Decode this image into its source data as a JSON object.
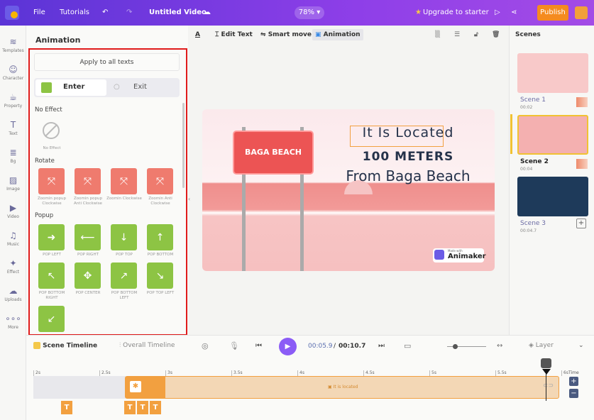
{
  "topbar": {
    "file": "File",
    "tutorials": "Tutorials",
    "title": "Untitled Video",
    "zoom": "78%",
    "upgrade": "Upgrade to starter",
    "publish": "Publish"
  },
  "rail": [
    {
      "label": "Templates",
      "icon": "template-icon"
    },
    {
      "label": "Character",
      "icon": "character-icon"
    },
    {
      "label": "Property",
      "icon": "property-icon"
    },
    {
      "label": "Text",
      "icon": "text-icon"
    },
    {
      "label": "Bg",
      "icon": "bg-icon"
    },
    {
      "label": "Image",
      "icon": "image-icon"
    },
    {
      "label": "Video",
      "icon": "video-icon"
    },
    {
      "label": "Music",
      "icon": "music-icon"
    },
    {
      "label": "Effect",
      "icon": "effect-icon"
    },
    {
      "label": "Uploads",
      "icon": "upload-icon"
    },
    {
      "label": "More",
      "icon": "more-icon"
    }
  ],
  "panel": {
    "title": "Animation",
    "apply": "Apply to all texts",
    "enter": "Enter",
    "exit": "Exit",
    "no_effect_section": "No Effect",
    "no_effect_label": "No Effect",
    "rotate_section": "Rotate",
    "rotate": [
      "Zoomin popup Clockwise",
      "Zoomin popup Anti Clockwise",
      "Zoomin Clockwise",
      "Zoomin Anti Clockwise"
    ],
    "popup_section": "Popup",
    "popup": [
      "POP LEFT",
      "POP RIGHT",
      "POP TOP",
      "POP BOTTOM",
      "POP BOTTOM RIGHT",
      "POP CENTER",
      "POP BOTTOM LEFT",
      "POP TOP LEFT"
    ]
  },
  "canvas_toolbar": {
    "edit_text": "Edit Text",
    "smart_move": "Smart move",
    "animation": "Animation"
  },
  "canvas": {
    "sign": "BAGA BEACH",
    "line1": "It Is Located",
    "line2": "100 METERS",
    "line3": "From Baga Beach",
    "watermark_small": "Made with",
    "watermark": "Animaker"
  },
  "scenes": {
    "title": "Scenes",
    "items": [
      {
        "name": "Scene 1",
        "time": "00:02",
        "color": "#f8c9c9"
      },
      {
        "name": "Scene 2",
        "time": "00:04",
        "color": "#f4b0b0"
      },
      {
        "name": "Scene 3",
        "time": "00:04.7",
        "color": "#1e3a5a"
      }
    ]
  },
  "timeline": {
    "scene_tab": "Scene Timeline",
    "overall_tab": "Overall Timeline",
    "current": "00:05.9",
    "total": "00:10.7",
    "layer": "Layer",
    "time_label": "Time",
    "ticks": [
      "2s",
      "2.5s",
      "3s",
      "3.5s",
      "4s",
      "4.5s",
      "5s",
      "5.5s",
      "6s"
    ],
    "clip_label": "It is located",
    "track_letter": "T"
  },
  "colors": {
    "accent": "#7c3aed",
    "publish": "#f58b1f",
    "clip": "#f2a040"
  }
}
